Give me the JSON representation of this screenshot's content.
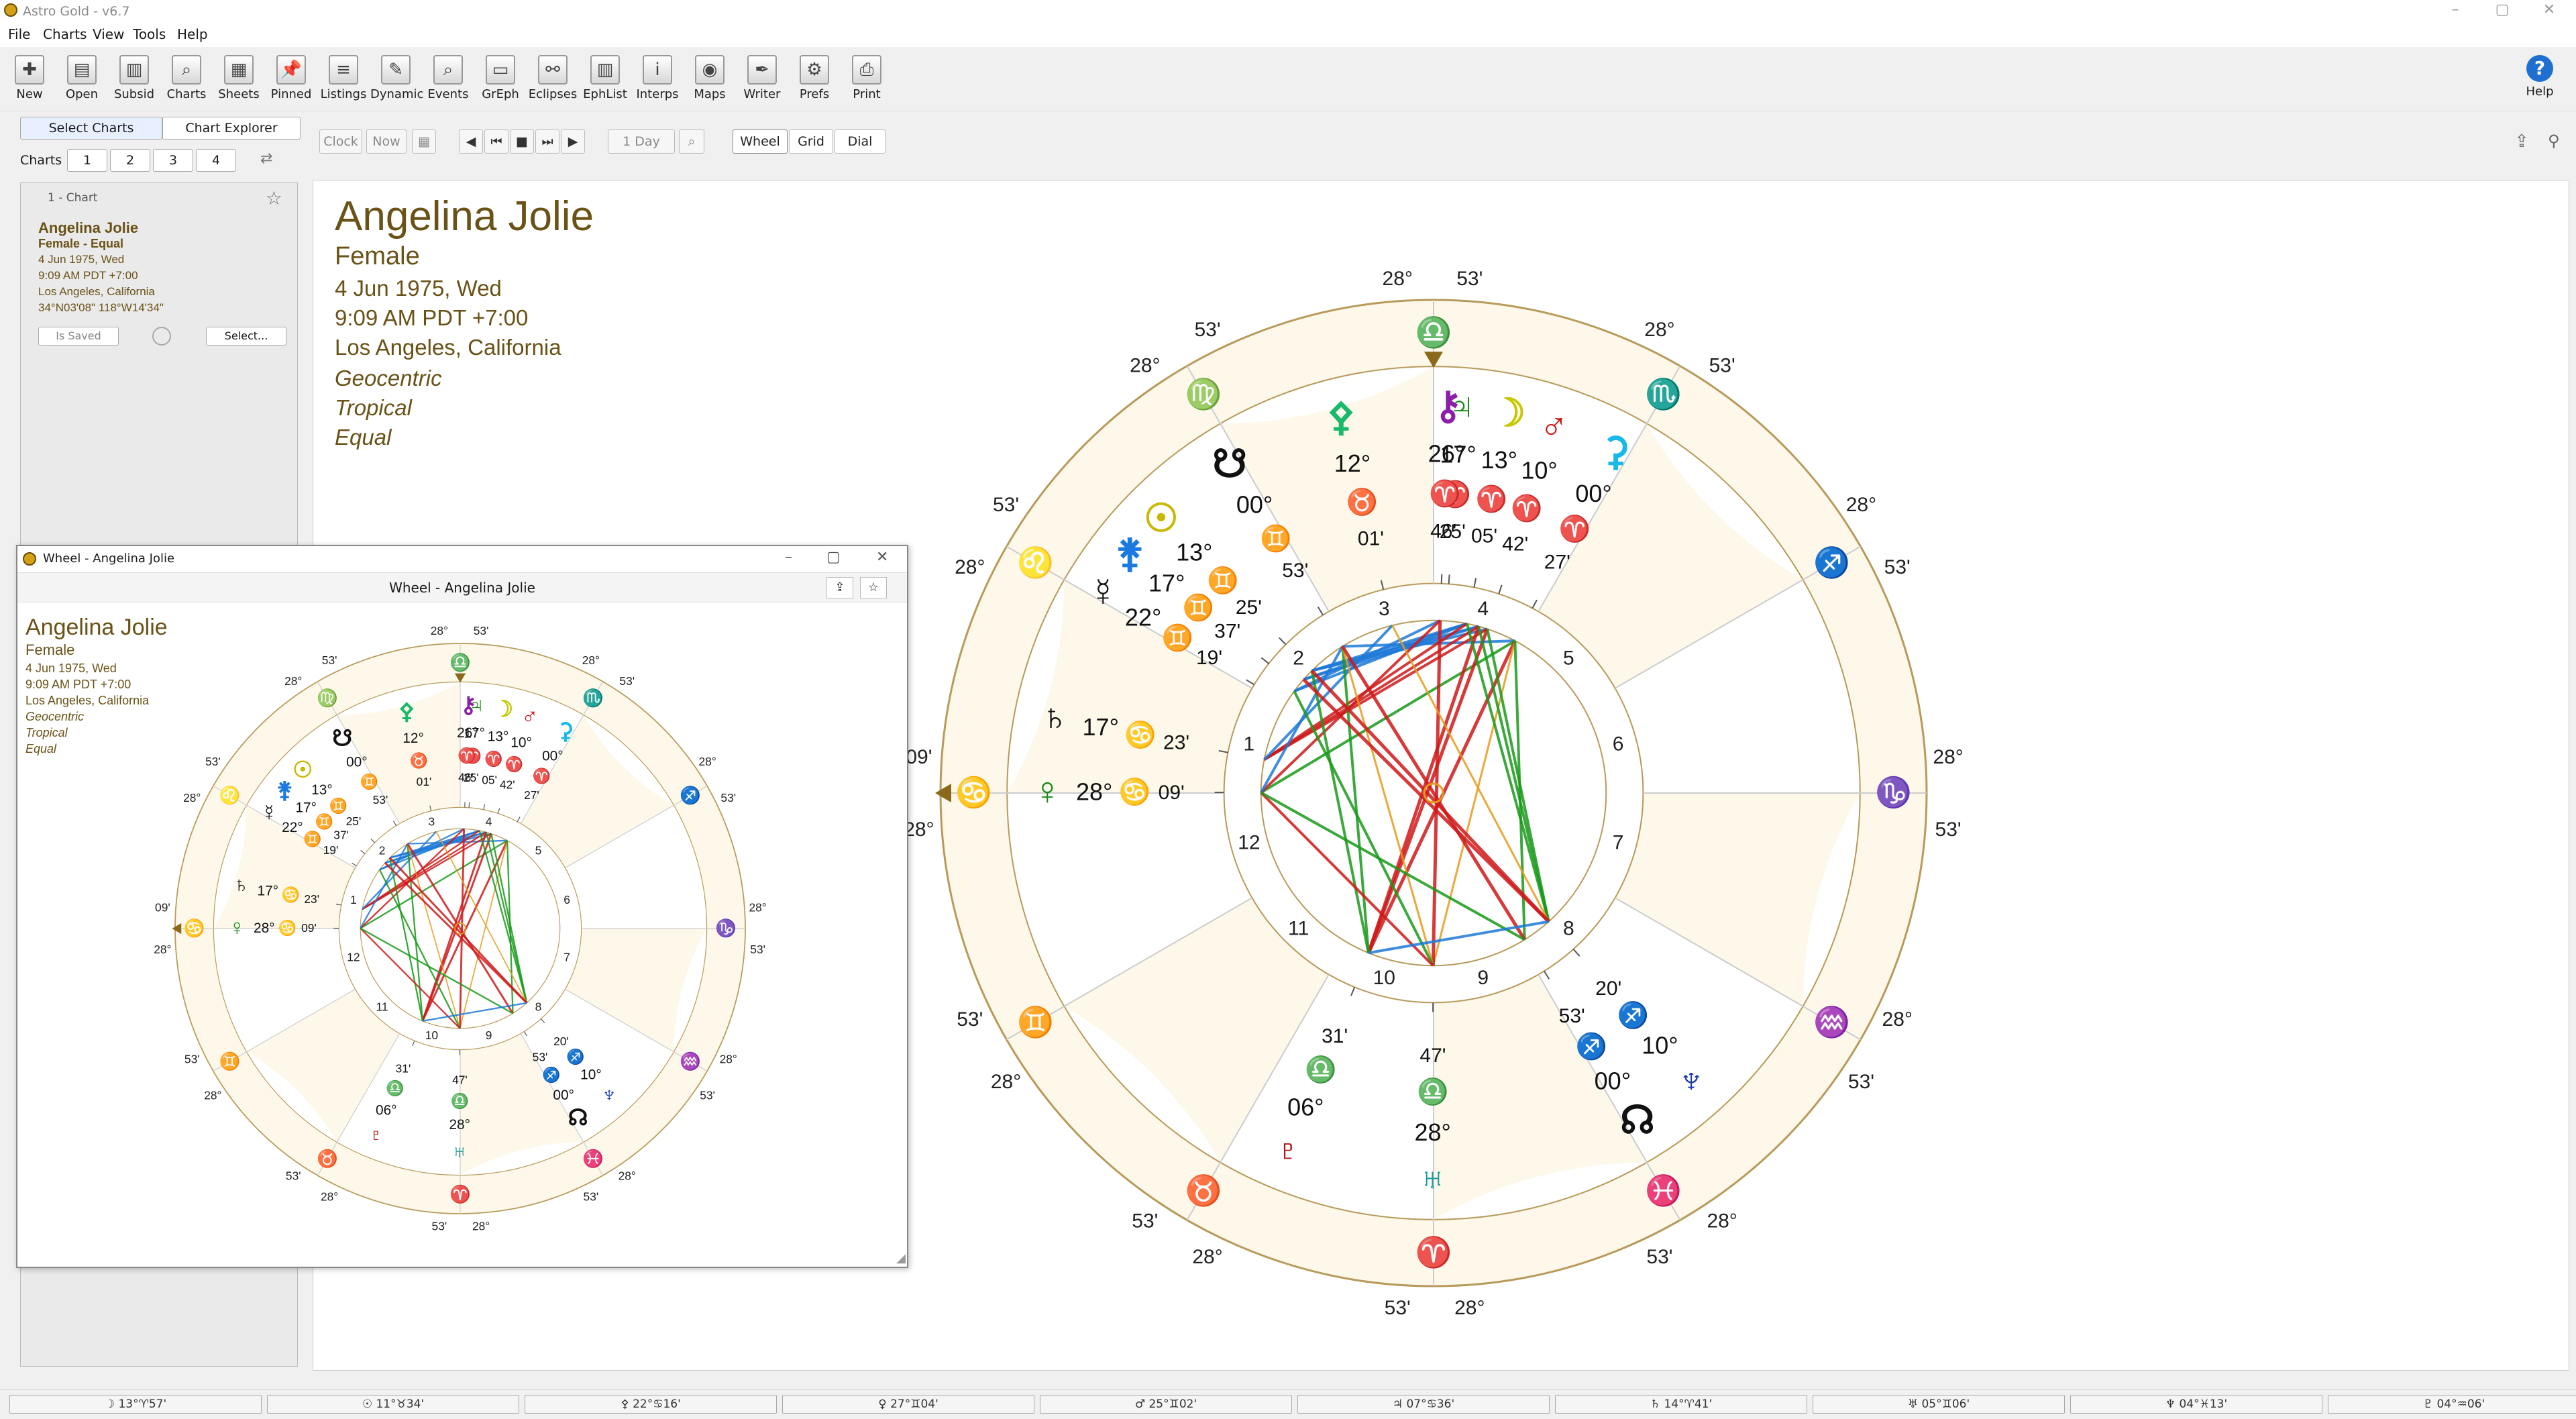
{
  "window": {
    "title": "Astro Gold - v6.7"
  },
  "menu": [
    "File",
    "Charts",
    "View",
    "Tools",
    "Help"
  ],
  "toolbar": [
    {
      "label": "New",
      "icon": "new-chart-icon"
    },
    {
      "label": "Open",
      "icon": "open-icon"
    },
    {
      "label": "Subsid",
      "icon": "subsid-icon"
    },
    {
      "label": "Charts",
      "icon": "charts-icon"
    },
    {
      "label": "Sheets",
      "icon": "sheets-icon"
    },
    {
      "label": "Pinned",
      "icon": "pin-icon"
    },
    {
      "label": "Listings",
      "icon": "listings-icon"
    },
    {
      "label": "Dynamic",
      "icon": "dynamic-icon"
    },
    {
      "label": "Events",
      "icon": "events-icon"
    },
    {
      "label": "GrEph",
      "icon": "graph-icon"
    },
    {
      "label": "Eclipses",
      "icon": "eclipse-icon"
    },
    {
      "label": "EphList",
      "icon": "ephlist-icon"
    },
    {
      "label": "Interps",
      "icon": "info-icon"
    },
    {
      "label": "Maps",
      "icon": "globe-icon"
    },
    {
      "label": "Writer",
      "icon": "quill-icon"
    },
    {
      "label": "Prefs",
      "icon": "gear-icon"
    },
    {
      "label": "Print",
      "icon": "printer-icon"
    }
  ],
  "help_label": "Help",
  "left": {
    "tabs": [
      "Select Charts",
      "Chart Explorer"
    ],
    "charts_label": "Charts",
    "chart_slots": [
      "1",
      "2",
      "3",
      "4"
    ],
    "card": {
      "header": "1 - Chart",
      "name": "Angelina Jolie",
      "type": "Female - Equal",
      "date": "4 Jun 1975, Wed",
      "time": "9:09 AM PDT +7:00",
      "place": "Los Angeles, California",
      "coords": "34°N03'08\" 118°W14'34\"",
      "saved_btn": "Is Saved",
      "select_btn": "Select..."
    }
  },
  "controls": {
    "clock": "Clock",
    "now": "Now",
    "step": "1 Day",
    "views": [
      "Wheel",
      "Grid",
      "Dial"
    ]
  },
  "chart": {
    "name": "Angelina Jolie",
    "gender": "Female",
    "date": "4 Jun 1975, Wed",
    "time": "9:09 AM PDT +7:00",
    "place": "Los Angeles, California",
    "system": "Geocentric",
    "zodiac": "Tropical",
    "houses": "Equal"
  },
  "subwindow": {
    "title": "Wheel - Angelina Jolie",
    "inner_title": "Wheel - Angelina Jolie"
  },
  "wheel": {
    "cusps": [
      {
        "n": "1",
        "deg": "28°",
        "sign": "♋",
        "min": "09'"
      },
      {
        "n": "2",
        "deg": "28°",
        "sign": "♌",
        "min": "53'"
      },
      {
        "n": "3",
        "deg": "28°",
        "sign": "♍",
        "min": "53'"
      },
      {
        "n": "4",
        "deg": "28°",
        "sign": "♎",
        "min": "53'"
      },
      {
        "n": "5",
        "deg": "28°",
        "sign": "♏",
        "min": "53'"
      },
      {
        "n": "6",
        "deg": "28°",
        "sign": "♐",
        "min": "53'"
      },
      {
        "n": "7",
        "deg": "28°",
        "sign": "♑",
        "min": "53'"
      },
      {
        "n": "8",
        "deg": "28°",
        "sign": "♒",
        "min": "53'"
      },
      {
        "n": "9",
        "deg": "28°",
        "sign": "♓",
        "min": "53'"
      },
      {
        "n": "10",
        "deg": "28°",
        "sign": "♈",
        "min": "53'"
      },
      {
        "n": "11",
        "deg": "28°",
        "sign": "♉",
        "min": "53'"
      },
      {
        "n": "12",
        "deg": "28°",
        "sign": "♊",
        "min": "53'"
      }
    ],
    "planets": [
      {
        "glyph": "⚷",
        "deg": "26°",
        "sign": "♈",
        "min": "46'",
        "color": "#8b1fa8"
      },
      {
        "glyph": "♃",
        "deg": "17°",
        "sign": "♈",
        "min": "25'",
        "color": "#1a8a1a"
      },
      {
        "glyph": "☽",
        "deg": "13°",
        "sign": "♈",
        "min": "05'",
        "color": "#c8c800"
      },
      {
        "glyph": "♂",
        "deg": "10°",
        "sign": "♈",
        "min": "42'",
        "color": "#d01818"
      },
      {
        "glyph": "⚳",
        "deg": "00°",
        "sign": "♈",
        "min": "27'",
        "color": "#18b8e8"
      },
      {
        "glyph": "⚴",
        "deg": "12°",
        "sign": "♉",
        "min": "01'",
        "color": "#1ab86a"
      },
      {
        "glyph": "☋",
        "deg": "00°",
        "sign": "♊",
        "min": "53'",
        "color": "#111"
      },
      {
        "glyph": "☉",
        "deg": "13°",
        "sign": "♊",
        "min": "25'",
        "color": "#c8b800"
      },
      {
        "glyph": "⚵",
        "deg": "17°",
        "sign": "♊",
        "min": "37'",
        "color": "#1a7ae0"
      },
      {
        "glyph": "☿",
        "deg": "22°",
        "sign": "♊",
        "min": "19'",
        "color": "#111"
      },
      {
        "glyph": "♄",
        "deg": "17°",
        "sign": "♋",
        "min": "23'",
        "color": "#111"
      },
      {
        "glyph": "♀",
        "deg": "28°",
        "sign": "♋",
        "min": "09'",
        "color": "#1a8a1a"
      },
      {
        "glyph": "♇",
        "deg": "06°",
        "sign": "♎",
        "min": "31'",
        "color": "#b01818"
      },
      {
        "glyph": "♅",
        "deg": "28°",
        "sign": "♎",
        "min": "47'",
        "color": "#1a9a9a"
      },
      {
        "glyph": "♆",
        "deg": "10°",
        "sign": "♐",
        "min": "20'",
        "color": "#1a3aa8"
      },
      {
        "glyph": "☊",
        "deg": "00°",
        "sign": "♐",
        "min": "53'",
        "color": "#111"
      }
    ]
  },
  "status": [
    "☽ 13°♈57'",
    "☉ 11°♉34'",
    "⚴ 22°♋16'",
    "♀ 27°♊04'",
    "♂ 25°♊02'",
    "♃ 07°♋36'",
    "♄ 14°♈41'",
    "♅ 05°♊06'",
    "♆ 04°♓13'",
    "♇ 04°♒06'"
  ],
  "colors": {
    "panel_bg": "#fdf8ea",
    "ring_line": "#b89a5a",
    "heading": "#6a5217",
    "red": "#d01818",
    "green": "#1a9a1a",
    "blue": "#1e7ad8",
    "orange": "#e89a1a"
  }
}
